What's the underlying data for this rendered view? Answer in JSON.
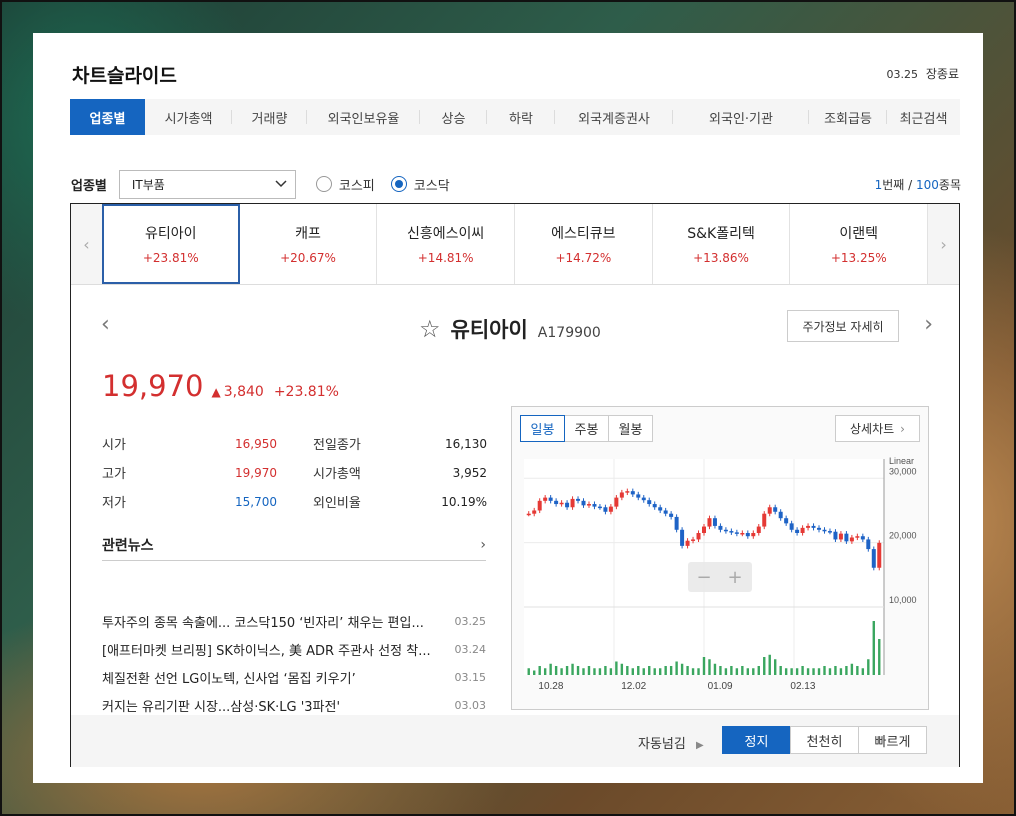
{
  "title": "차트슬라이드",
  "header": {
    "date": "03.25",
    "status": "장종료"
  },
  "tabs": [
    "업종별",
    "시가총액",
    "거래량",
    "외국인보유율",
    "상승",
    "하락",
    "외국계증권사",
    "외국인·기관",
    "조회급등",
    "최근검색"
  ],
  "filter": {
    "label": "업종별",
    "selected": "IT부품",
    "markets": [
      "코스피",
      "코스닥"
    ],
    "market_selected": "코스닥",
    "page_current": "1",
    "page_unit": "번째",
    "page_total": "100",
    "page_total_unit": "종목"
  },
  "strip": [
    {
      "name": "유티아이",
      "change": "+23.81%"
    },
    {
      "name": "캐프",
      "change": "+20.67%"
    },
    {
      "name": "신흥에스이씨",
      "change": "+14.81%"
    },
    {
      "name": "에스티큐브",
      "change": "+14.72%"
    },
    {
      "name": "S&K폴리텍",
      "change": "+13.86%"
    },
    {
      "name": "이랜텍",
      "change": "+13.25%"
    }
  ],
  "stock": {
    "name": "유티아이",
    "code": "A179900",
    "detail_btn": "주가정보 자세히",
    "price": "19,970",
    "diff": "3,840",
    "rate": "+23.81%",
    "rows": [
      {
        "k1": "시가",
        "v1": "16,950",
        "c1": "#d32f2f",
        "k2": "전일종가",
        "v2": "16,130"
      },
      {
        "k1": "고가",
        "v1": "19,970",
        "c1": "#d32f2f",
        "k2": "시가총액",
        "v2": "3,952"
      },
      {
        "k1": "저가",
        "v1": "15,700",
        "c1": "#1565c0",
        "k2": "외인비율",
        "v2": "10.19%"
      }
    ]
  },
  "news": {
    "title": "관련뉴스",
    "items": [
      {
        "text": "투자주의 종목 속출에... 코스닥150 ‘빈자리’ 채우는 편입...",
        "date": "03.25"
      },
      {
        "text": "[애프터마켓 브리핑] SK하이닉스, 美 ADR 주관사 선정 착...",
        "date": "03.24"
      },
      {
        "text": "체질전환 선언 LG이노텍, 신사업 ‘몸집 키우기’",
        "date": "03.15"
      },
      {
        "text": "커지는 유리기판 시장...삼성·SK·LG '3파전'",
        "date": "03.03"
      }
    ]
  },
  "chart_tabs": [
    "일봉",
    "주봉",
    "월봉"
  ],
  "chart_detail": "상세차트",
  "chart_data": {
    "type": "line",
    "scale": "Linear",
    "x_ticks": [
      "10.28",
      "12.02",
      "01.09",
      "02.13"
    ],
    "y_ticks": [
      10000,
      20000,
      30000
    ],
    "y_tick_labels": [
      "10,000",
      "20,000",
      "30,000"
    ],
    "ylim": [
      10000,
      33000
    ],
    "close": [
      24500,
      25000,
      26500,
      27000,
      26500,
      26000,
      26200,
      25500,
      26800,
      26500,
      25800,
      26000,
      25600,
      25500,
      24800,
      25600,
      27000,
      27800,
      28000,
      27500,
      27000,
      26600,
      26000,
      25500,
      25000,
      24500,
      24000,
      22000,
      19500,
      20300,
      20500,
      21500,
      22500,
      23800,
      22600,
      22000,
      21800,
      21600,
      21400,
      21500,
      21000,
      21500,
      22500,
      24500,
      25500,
      24800,
      23800,
      23000,
      22000,
      21500,
      22300,
      22600,
      22300,
      22000,
      21800,
      21700,
      20500,
      21400,
      20200,
      20800,
      21000,
      20500,
      19000,
      16100,
      19970
    ],
    "green": "#3aa65f",
    "up_color": "#e53935",
    "down_color": "#1e63c6",
    "volume": [
      3,
      2,
      4,
      3,
      5,
      4,
      3,
      4,
      5,
      4,
      3,
      4,
      3,
      3,
      4,
      3,
      6,
      5,
      4,
      3,
      4,
      3,
      4,
      3,
      3,
      4,
      4,
      6,
      5,
      4,
      3,
      3,
      8,
      7,
      5,
      4,
      3,
      4,
      3,
      4,
      3,
      3,
      4,
      8,
      9,
      7,
      4,
      3,
      3,
      3,
      4,
      3,
      3,
      3,
      4,
      3,
      4,
      3,
      4,
      5,
      4,
      3,
      7,
      24,
      16
    ]
  },
  "footer": {
    "auto_label": "자동넘김",
    "buttons": [
      "정지",
      "천천히",
      "빠르게"
    ]
  },
  "colors": {
    "accent": "#1565c0",
    "up": "#d32f2f",
    "down": "#1565c0"
  }
}
